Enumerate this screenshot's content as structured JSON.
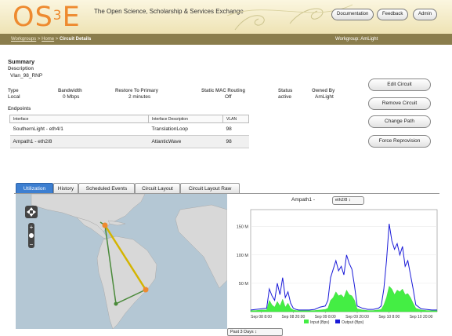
{
  "header": {
    "logo": {
      "prefix": "O",
      "s": "S",
      "sup": "3",
      "e": "E"
    },
    "tagline": "The Open Science, Scholarship & Services Exchange",
    "buttons": {
      "documentation": "Documentation",
      "feedback": "Feedback",
      "admin": "Admin"
    }
  },
  "nav": {
    "crumb_workgroups": "Workgroups",
    "crumb_home": "Home",
    "crumb_current": "Circuit Details",
    "separator": ">",
    "workgroup": "Workgroup: AmLight"
  },
  "summary": {
    "title": "Summary",
    "description_label": "Description",
    "description": "Vlan_98_RNP",
    "type_label": "Type",
    "type": "Local",
    "bandwidth_label": "Bandwidth",
    "bandwidth": "0 Mbps",
    "restore_label": "Restore To Primary",
    "restore": "2 minutes",
    "mac_label": "Static MAC Routing",
    "mac": "Off",
    "status_label": "Status",
    "status": "active",
    "owner_label": "Owned By",
    "owner": "AmLight",
    "endpoints_label": "Endpoints"
  },
  "endpoints": {
    "headers": {
      "interface": "Interface",
      "description": "Interface Description",
      "vlan": "VLAN"
    },
    "rows": [
      {
        "interface": "SouthernLight - eth4/1",
        "description": "TranslationLoop",
        "vlan": "98"
      },
      {
        "interface": "Ampath1 - eth2/8",
        "description": "AtlanticWave",
        "vlan": "98"
      }
    ]
  },
  "actions": {
    "edit": "Edit Circuit",
    "remove": "Remove Circuit",
    "change_path": "Change Path",
    "force": "Force Reprovision"
  },
  "tabs": [
    "Utilization",
    "History",
    "Scheduled Events",
    "Circuit Layout",
    "Circuit Layout Raw"
  ],
  "graph": {
    "title_node": "Ampath1 -",
    "interface_select": "eth2/8",
    "range_select": "Past 3 Days",
    "select_arrow": "↕"
  },
  "colors": {
    "accent_tab": "#3d7fd1",
    "logo": "#ee8a2f",
    "input_series": "#44ee44",
    "output_series": "#1a1ad8",
    "path_primary": "#d4b400",
    "path_backup": "#4a8a3a"
  },
  "chart_data": {
    "type": "area",
    "ylim": [
      0,
      180
    ],
    "yticks": [
      50,
      100,
      150
    ],
    "ytick_labels": [
      "50 M",
      "100 M",
      "150 M"
    ],
    "x_tick_labels": [
      "Sep 08 8:00",
      "Sep 08 20:00",
      "Sep 09 8:00",
      "Sep 09 20:00",
      "Sep 10 8:00",
      "Sep 10 20:00"
    ],
    "x_tick_pos": [
      0,
      12,
      24,
      36,
      48,
      60
    ],
    "xlim": [
      -4,
      66
    ],
    "series": [
      {
        "name": "Input (Bps)",
        "color": "#44ee44",
        "x": [
          -4,
          -2,
          0,
          2,
          3,
          4,
          5,
          6,
          7,
          8,
          9,
          10,
          11,
          12,
          13,
          14,
          16,
          18,
          20,
          22,
          24,
          25,
          26,
          27,
          28,
          29,
          30,
          31,
          32,
          33,
          34,
          35,
          36,
          38,
          40,
          42,
          44,
          45,
          46,
          47,
          48,
          49,
          50,
          51,
          52,
          53,
          54,
          55,
          56,
          57,
          58,
          60,
          62,
          64,
          66
        ],
        "values": [
          2,
          2,
          3,
          3,
          20,
          12,
          8,
          18,
          10,
          22,
          8,
          15,
          6,
          3,
          2,
          2,
          2,
          2,
          2,
          3,
          4,
          6,
          20,
          25,
          35,
          28,
          30,
          25,
          38,
          30,
          28,
          20,
          5,
          3,
          2,
          2,
          3,
          4,
          12,
          25,
          45,
          40,
          30,
          38,
          35,
          40,
          30,
          32,
          25,
          15,
          6,
          3,
          2,
          2,
          2
        ]
      },
      {
        "name": "Output (Bps)",
        "color": "#1a1ad8",
        "x": [
          -4,
          -2,
          0,
          2,
          3,
          4,
          5,
          6,
          7,
          8,
          9,
          10,
          11,
          12,
          13,
          14,
          16,
          18,
          20,
          22,
          24,
          25,
          26,
          27,
          28,
          29,
          30,
          31,
          32,
          33,
          34,
          35,
          36,
          38,
          40,
          42,
          44,
          45,
          46,
          47,
          48,
          49,
          50,
          51,
          52,
          53,
          54,
          55,
          56,
          57,
          58,
          60,
          62,
          64,
          66
        ],
        "values": [
          3,
          4,
          5,
          6,
          40,
          28,
          20,
          50,
          30,
          60,
          25,
          35,
          15,
          6,
          4,
          3,
          3,
          3,
          4,
          8,
          10,
          20,
          60,
          75,
          90,
          72,
          80,
          65,
          100,
          85,
          75,
          45,
          10,
          6,
          4,
          4,
          6,
          10,
          40,
          90,
          155,
          125,
          110,
          120,
          100,
          115,
          80,
          90,
          65,
          40,
          12,
          5,
          4,
          3,
          3
        ]
      }
    ]
  }
}
